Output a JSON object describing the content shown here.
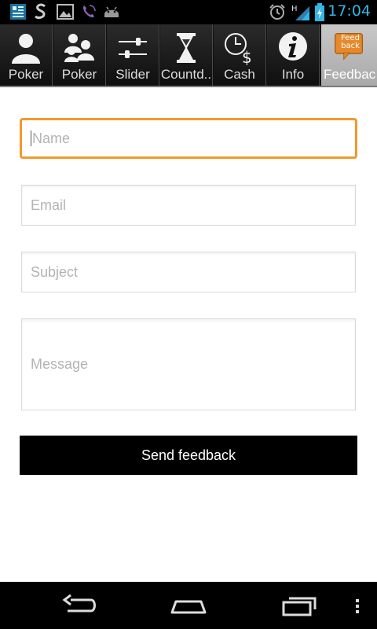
{
  "status_bar": {
    "time": "17:04",
    "icons": [
      "notification-icon",
      "swipe-icon",
      "gallery-icon",
      "viber-icon",
      "android-icon",
      "alarm-icon",
      "signal-icon",
      "battery-icon"
    ]
  },
  "tabs": [
    {
      "label": "Poker",
      "icon": "single-user-icon"
    },
    {
      "label": "Poker",
      "icon": "multi-user-icon"
    },
    {
      "label": "Slider",
      "icon": "sliders-icon"
    },
    {
      "label": "Countd..",
      "icon": "hourglass-icon"
    },
    {
      "label": "Cash",
      "icon": "clock-dollar-icon"
    },
    {
      "label": "Info",
      "icon": "info-icon"
    },
    {
      "label": "Feedbac",
      "icon": "feedback-bubble-icon",
      "icon_text": "Feed back",
      "active": true
    }
  ],
  "form": {
    "name_placeholder": "Name",
    "email_placeholder": "Email",
    "subject_placeholder": "Subject",
    "message_placeholder": "Message",
    "send_label": "Send feedback"
  },
  "colors": {
    "focus_border": "#f19a2b",
    "status_clock": "#33b5e5",
    "button_bg": "#000000"
  }
}
